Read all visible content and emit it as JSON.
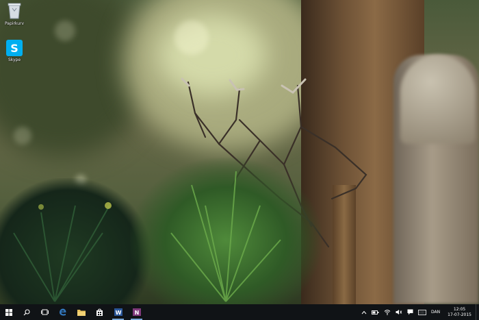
{
  "desktop": {
    "icons": [
      {
        "label": "Papirkurv",
        "icon": "recycle-bin-icon"
      },
      {
        "label": "Skype",
        "icon": "skype-icon"
      }
    ]
  },
  "taskbar": {
    "pinned": [
      {
        "name": "start",
        "icon": "windows-logo-icon"
      },
      {
        "name": "search",
        "icon": "search-icon"
      },
      {
        "name": "task-view",
        "icon": "task-view-icon"
      },
      {
        "name": "edge",
        "icon": "edge-icon"
      },
      {
        "name": "file-explorer",
        "icon": "folder-icon"
      },
      {
        "name": "store",
        "icon": "store-icon"
      },
      {
        "name": "word",
        "icon": "word-icon"
      },
      {
        "name": "onenote",
        "icon": "onenote-icon"
      }
    ],
    "tray": {
      "language": "DAN",
      "time": "12:05",
      "date": "17-07-2015"
    }
  },
  "colors": {
    "taskbar": "#101316",
    "skype": "#00aff0",
    "word": "#2b579a",
    "onenote": "#80397b",
    "edge": "#3277bc"
  }
}
